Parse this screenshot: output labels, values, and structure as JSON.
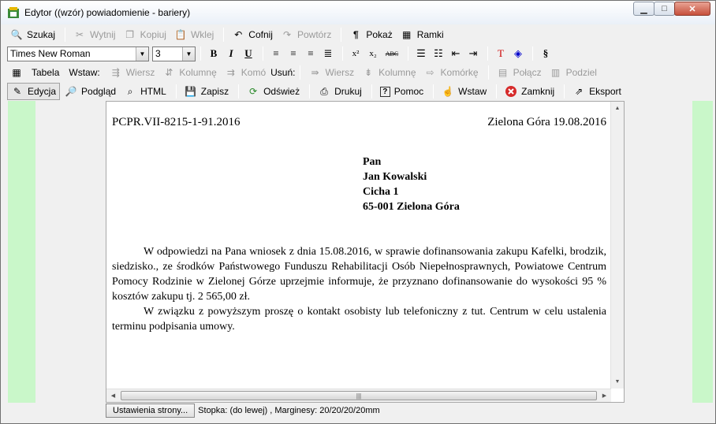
{
  "window": {
    "title": "Edytor  ((wzór) powiadomienie - bariery)"
  },
  "toolbar1": {
    "search": "Szukaj",
    "cut": "Wytnij",
    "copy": "Kopiuj",
    "paste": "Wklej",
    "undo": "Cofnij",
    "redo": "Powtórz",
    "show": "Pokaż",
    "frames": "Ramki"
  },
  "toolbar2": {
    "font": "Times New Roman",
    "size": "3",
    "bold": "B",
    "italic": "I",
    "underline": "U",
    "sup": "x²",
    "sub": "x₂",
    "strike": "ABC",
    "section": "§"
  },
  "toolbar3": {
    "table": "Tabela",
    "insert": "Wstaw:",
    "row": "Wiersz",
    "column": "Kolumnę",
    "cell": "Komó",
    "delete": "Usuń:",
    "row2": "Wiersz",
    "column2": "Kolumnę",
    "cell2": "Komórkę",
    "merge": "Połącz",
    "split": "Podziel"
  },
  "toolbar4": {
    "edit": "Edycja",
    "preview": "Podgląd",
    "html": "HTML",
    "save": "Zapisz",
    "refresh": "Odśwież",
    "print": "Drukuj",
    "help": "Pomoc",
    "insert": "Wstaw",
    "close": "Zamknij",
    "export": "Eksport"
  },
  "document": {
    "ref": "PCPR.VII-8215-1-91.2016",
    "place_date": "Zielona Góra 19.08.2016",
    "addr": [
      "Pan",
      "Jan Kowalski",
      "Cicha 1",
      "65-001 Zielona Góra"
    ],
    "p1": "W odpowiedzi na Pana wniosek z dnia 15.08.2016, w sprawie dofinansowania zakupu Kafelki, brodzik, siedzisko., ze środków Państwowego Funduszu Rehabilitacji Osób Niepełnosprawnych, Powiatowe Centrum Pomocy Rodzinie w Zielonej Górze uprzejmie informuje, że przyznano dofinansowanie do wysokości 95 % kosztów zakupu tj. 2 565,00 zł.",
    "p2": "W związku z powyższym proszę o kontakt osobisty lub telefoniczny z tut. Centrum w celu ustalenia terminu podpisania umowy."
  },
  "status": {
    "page_settings": "Ustawienia strony...",
    "info": "Stopka: (do lewej) ,  Marginesy: 20/20/20/20mm"
  }
}
